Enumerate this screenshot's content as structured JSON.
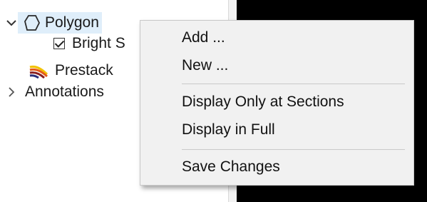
{
  "tree": {
    "items": [
      {
        "label": "Polygon",
        "icon": "polygon-icon",
        "expanded": true
      },
      {
        "label": "Bright S",
        "checked": true
      },
      {
        "label": "Prestack",
        "icon": "seismic-stripes-icon"
      },
      {
        "label": "Annotations",
        "expanded": false
      }
    ]
  },
  "context_menu": {
    "items": [
      "Add ...",
      "New ...",
      "Display Only at Sections",
      "Display in Full",
      "Save Changes"
    ]
  },
  "colors": {
    "selection": "#dfeefa",
    "viewport": "#000000",
    "menu_bg": "#f1f1f1"
  }
}
